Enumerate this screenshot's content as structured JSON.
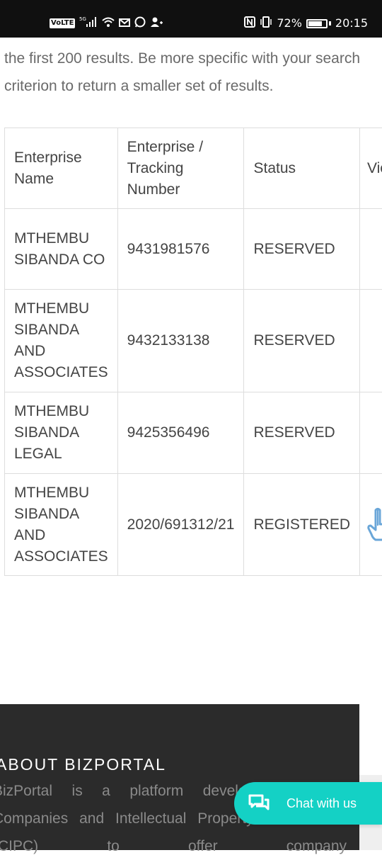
{
  "status_bar": {
    "network_badge": "VoLTE",
    "network_type": "5G",
    "battery_percent": "72%",
    "battery_level": 0.72,
    "time": "20:15",
    "left_icons": [
      "volte-icon",
      "signal-icon",
      "wifi-icon",
      "mail-icon",
      "whatsapp-icon",
      "person-icon"
    ],
    "right_icons": [
      "nfc-icon",
      "vibrate-icon",
      "battery-icon"
    ]
  },
  "intro": {
    "text": "the first 200 results. Be more specific with your search criterion to return a smaller set of results."
  },
  "table": {
    "headers": {
      "name_line1": "Enterprise",
      "name_line2": "Name",
      "number_line1": "Enterprise /",
      "number_line2": "Tracking",
      "number_line3": "Number",
      "status": "Status",
      "view": "View"
    },
    "rows": [
      {
        "name": "MTHEMBU SIBANDA CO",
        "number": "9431981576",
        "status": "RESERVED"
      },
      {
        "name": "MTHEMBU SIBANDA AND ASSOCIATES",
        "number": "9432133138",
        "status": "RESERVED"
      },
      {
        "name": "MTHEMBU SIBANDA LEGAL",
        "number": "9425356496",
        "status": "RESERVED"
      },
      {
        "name": "MTHEMBU SIBANDA AND ASSOCIATES",
        "number": "2020/691312/21",
        "status": "REGISTERED"
      }
    ],
    "view_icon": "pointer-hand-icon"
  },
  "footer": {
    "heading": "ABOUT BIZPORTAL",
    "text": "BizPortal is a platform developed by the Companies and Intellectual Property Commission (CIPC) to offer company"
  },
  "chat": {
    "label": "Chat with us",
    "icon": "chat-bubbles-icon"
  },
  "colors": {
    "status_bar": "#101010",
    "footer_bg": "#2b2b2b",
    "chat_accent": "#14d1c5",
    "pointer_icon": "#6aa6d8"
  }
}
